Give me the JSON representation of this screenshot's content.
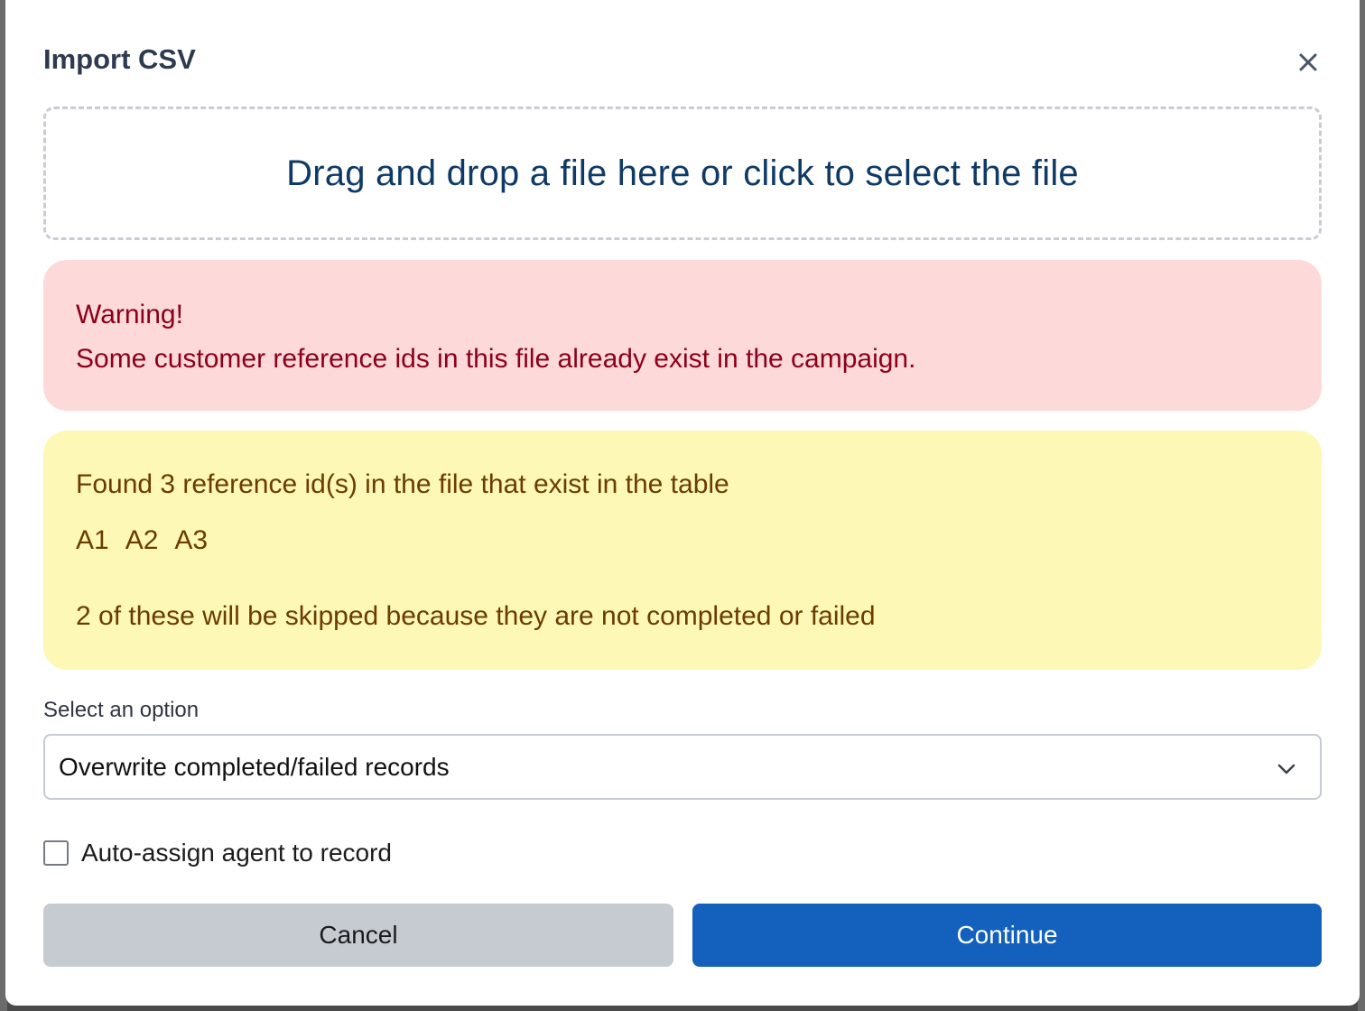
{
  "modal": {
    "title": "Import CSV",
    "close_icon": "close-icon"
  },
  "dropzone": {
    "text": "Drag and drop a file here or click to select the file"
  },
  "warning_alert": {
    "heading": "Warning!",
    "message": "Some customer reference ids in this file already exist in the campaign.",
    "color": "#8c0018",
    "background": "#fdd9da"
  },
  "info_alert": {
    "found_text": "Found 3 reference id(s) in the file that exist in the table",
    "ids": [
      "A1",
      "A2",
      "A3"
    ],
    "skip_text": "2 of these will be skipped because they are not completed or failed",
    "color": "#6b3c00",
    "background": "#fdf8b6"
  },
  "option_select": {
    "label": "Select an option",
    "selected_value": "Overwrite completed/failed records",
    "chevron_icon": "chevron-down-icon"
  },
  "auto_assign": {
    "label": "Auto-assign agent to record",
    "checked": false
  },
  "buttons": {
    "cancel_label": "Cancel",
    "continue_label": "Continue",
    "continue_color": "#1360bd",
    "cancel_color": "#c6cad1"
  }
}
